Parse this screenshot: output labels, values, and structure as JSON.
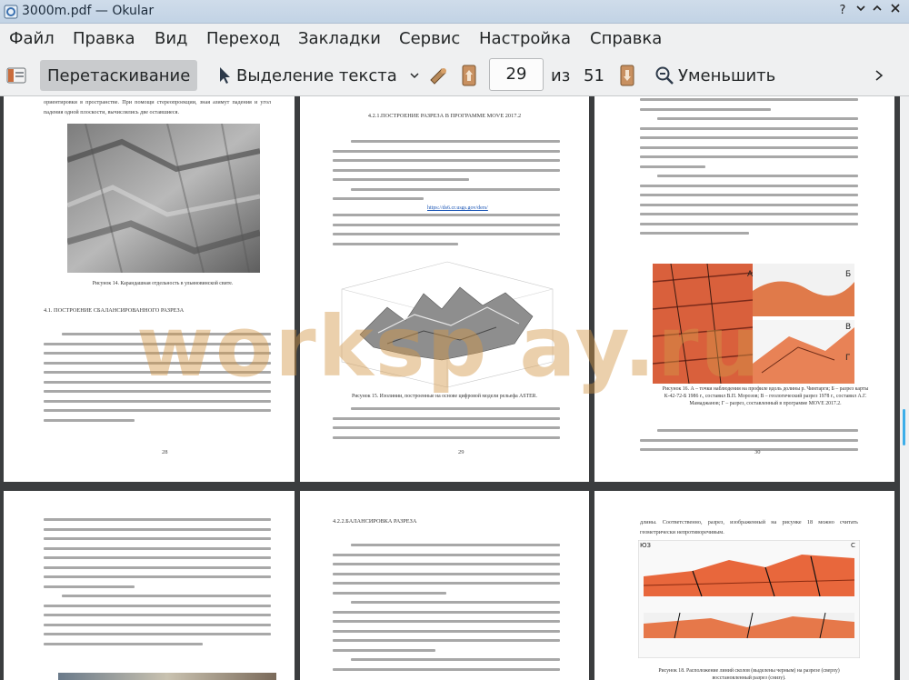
{
  "window": {
    "title": "3000m.pdf  — Okular",
    "buttons": {
      "help": "?",
      "minimize": "⌃",
      "maximize": "◇",
      "close": "✕"
    }
  },
  "menu": [
    "Файл",
    "Правка",
    "Вид",
    "Переход",
    "Закладки",
    "Сервис",
    "Настройка",
    "Справка"
  ],
  "toolbar": {
    "drag_mode": "Перетаскивание",
    "text_select": "Выделение текста",
    "page_current": "29",
    "page_of": "из",
    "page_total": "51",
    "zoom_out": "Уменьшить"
  },
  "pages": {
    "p28": {
      "top_text": "ориентировки в пространстве. При помощи стереопроекции, зная азимут падения и угол падения одной плоскости, вычислялись две оставшиеся.",
      "caption": "Рисунок 14.  Карандашная отдельность в ульяновинской свите.",
      "heading": "4.1.     ПОСТРОЕНИЕ СБАЛАНСИРОВАННОГО РАЗРЕЗА",
      "number": "28"
    },
    "p29": {
      "heading": "4.2.1.ПОСТРОЕНИЕ РАЗРЕЗА В ПРОГРАММЕ MOVE 2017.2",
      "link": "https://ds6.cr.usgs.gov/ders/",
      "caption": "Рисунок 15.   Изолинии, построенные на основе цифровой модели рельефа ASTER.",
      "number": "29"
    },
    "p30": {
      "caption": "Рисунок 16.   А – точки наблюдения на профиле вдоль долины р. Чимтарги; Б – разрез карты К-42-72-Б 1986 г., составил В.П. Морозов; В – геологический разрез 1978 г., составил А.Г. Мамаджанов; Г – разрез, составленный в программе MOVE 2017.2.",
      "number": "30",
      "labels": [
        "А",
        "Б",
        "В",
        "Г"
      ]
    },
    "p32": {
      "heading": "4.2.2.БАЛАНСИРОВКА РАЗРЕЗА"
    },
    "p33": {
      "top_text": "длины. Соответственно, разрез, изображенный на рисунке 18 можно считать геометрически непротиворечивым.",
      "caption": "Рисунок 18.  Расположение линий сколов (выделены черным) на разрезе (сверху) восстановленный разрез (снизу).",
      "label_ng": "ЮЗ",
      "label_c": "С"
    }
  },
  "watermark": "worksp ay.ru"
}
